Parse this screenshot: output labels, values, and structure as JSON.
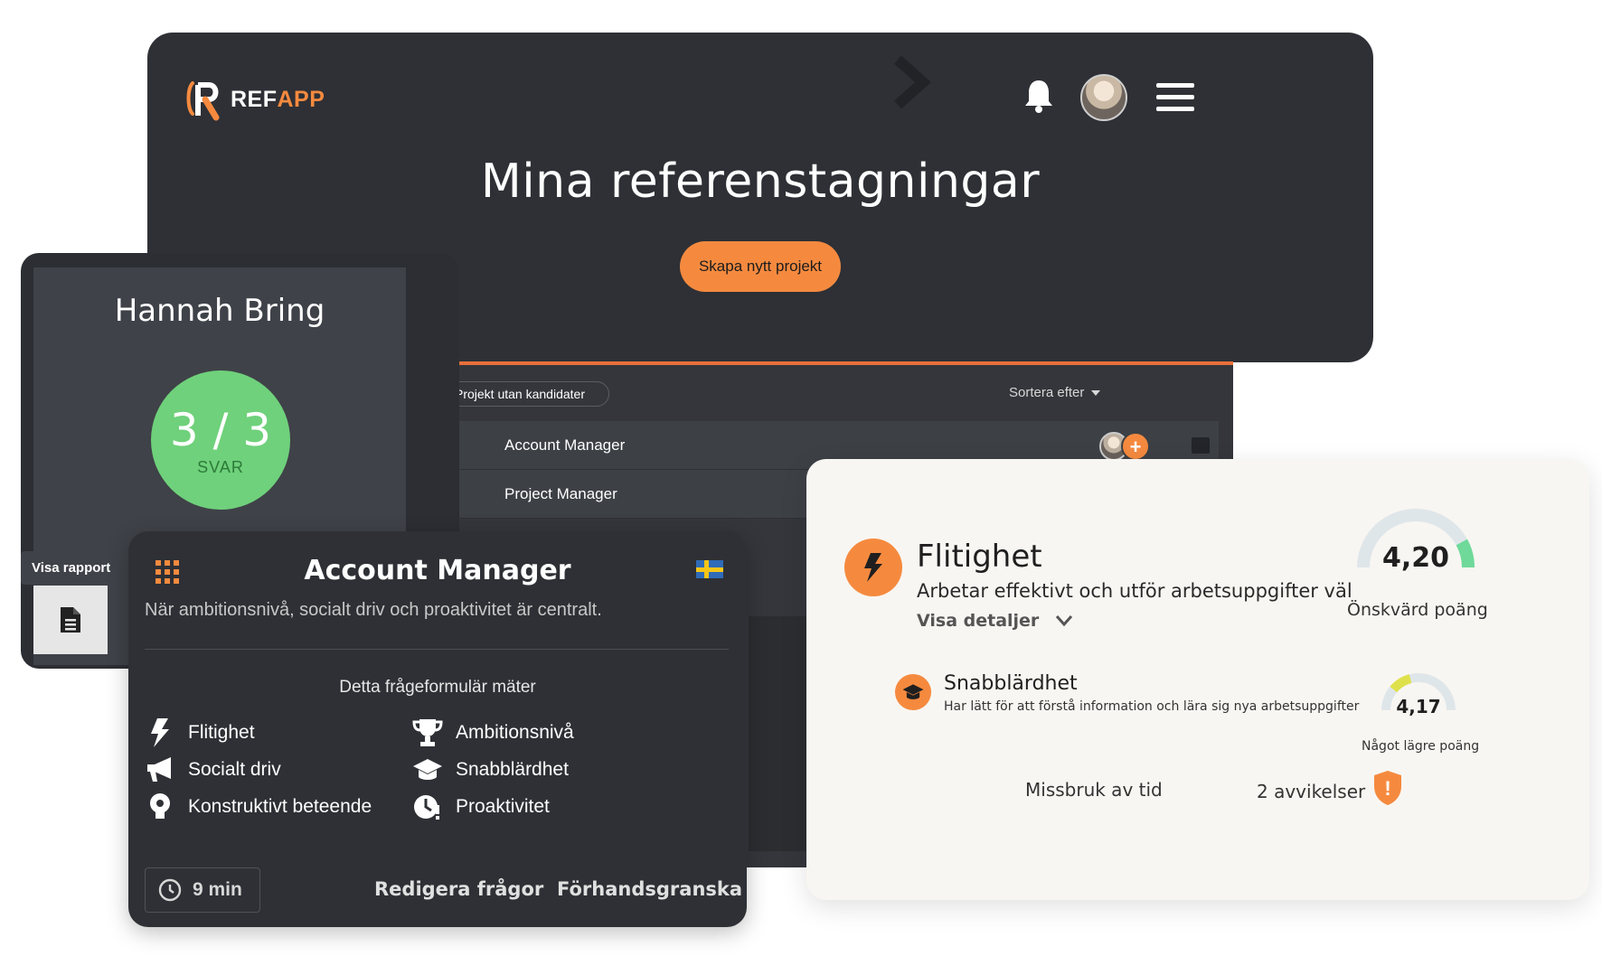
{
  "brand": {
    "logo_prefix": "REF",
    "logo_suffix": "APP",
    "accent": "#f58a3f"
  },
  "header": {
    "title": "Mina referenstagningar",
    "create_button": "Skapa nytt projekt"
  },
  "icons": {
    "bell": "bell-icon",
    "menu": "hamburger-menu-icon",
    "star": "star-icon",
    "archive": "archive-icon"
  },
  "project_list": {
    "filter": "Projekt utan kandidater",
    "sort_label": "Sortera efter",
    "rows": [
      {
        "name": "Account Manager",
        "add": "+"
      },
      {
        "name": "Project Manager"
      }
    ]
  },
  "candidate": {
    "name": "Hannah Bring",
    "score": "3 / 3",
    "score_label": "SVAR",
    "score_color": "#6fd17b",
    "report_label": "Visa rapport"
  },
  "questionnaire": {
    "title": "Account Manager",
    "subtitle": "När ambitionsnivå, socialt driv och proaktivitet är centralt.",
    "measures_title": "Detta frågeformulär mäter",
    "traits": [
      {
        "label": "Flitighet",
        "icon": "bolt-icon"
      },
      {
        "label": "Ambitionsnivå",
        "icon": "trophy-icon"
      },
      {
        "label": "Socialt driv",
        "icon": "megaphone-icon"
      },
      {
        "label": "Snabblärdhet",
        "icon": "graduation-cap-icon"
      },
      {
        "label": "Konstruktivt beteende",
        "icon": "lightbulb-icon"
      },
      {
        "label": "Proaktivitet",
        "icon": "clock-alert-icon"
      }
    ],
    "time": "9 min",
    "edit_link": "Redigera frågor",
    "preview_link": "Förhandsgranska"
  },
  "result": {
    "title": "Flitighet",
    "description": "Arbetar effektivt och utför arbetsuppgifter väl",
    "details_link": "Visa detaljer",
    "score": "4,20",
    "score_label": "Önskvärd poäng",
    "score_fraction": 0.84,
    "score_color": "#6fd999",
    "sub_title": "Snabblärdhet",
    "sub_description": "Har lätt för att förstå information och lära sig nya arbetsuppgifter",
    "sub_score": "4,17",
    "sub_score_label": "Något lägre poäng",
    "sub_score_fraction": 0.2,
    "sub_score_color": "#dfe14c",
    "misuse_label": "Missbruk av tid",
    "deviations_label": "2 avvikelser",
    "warning": "!"
  }
}
